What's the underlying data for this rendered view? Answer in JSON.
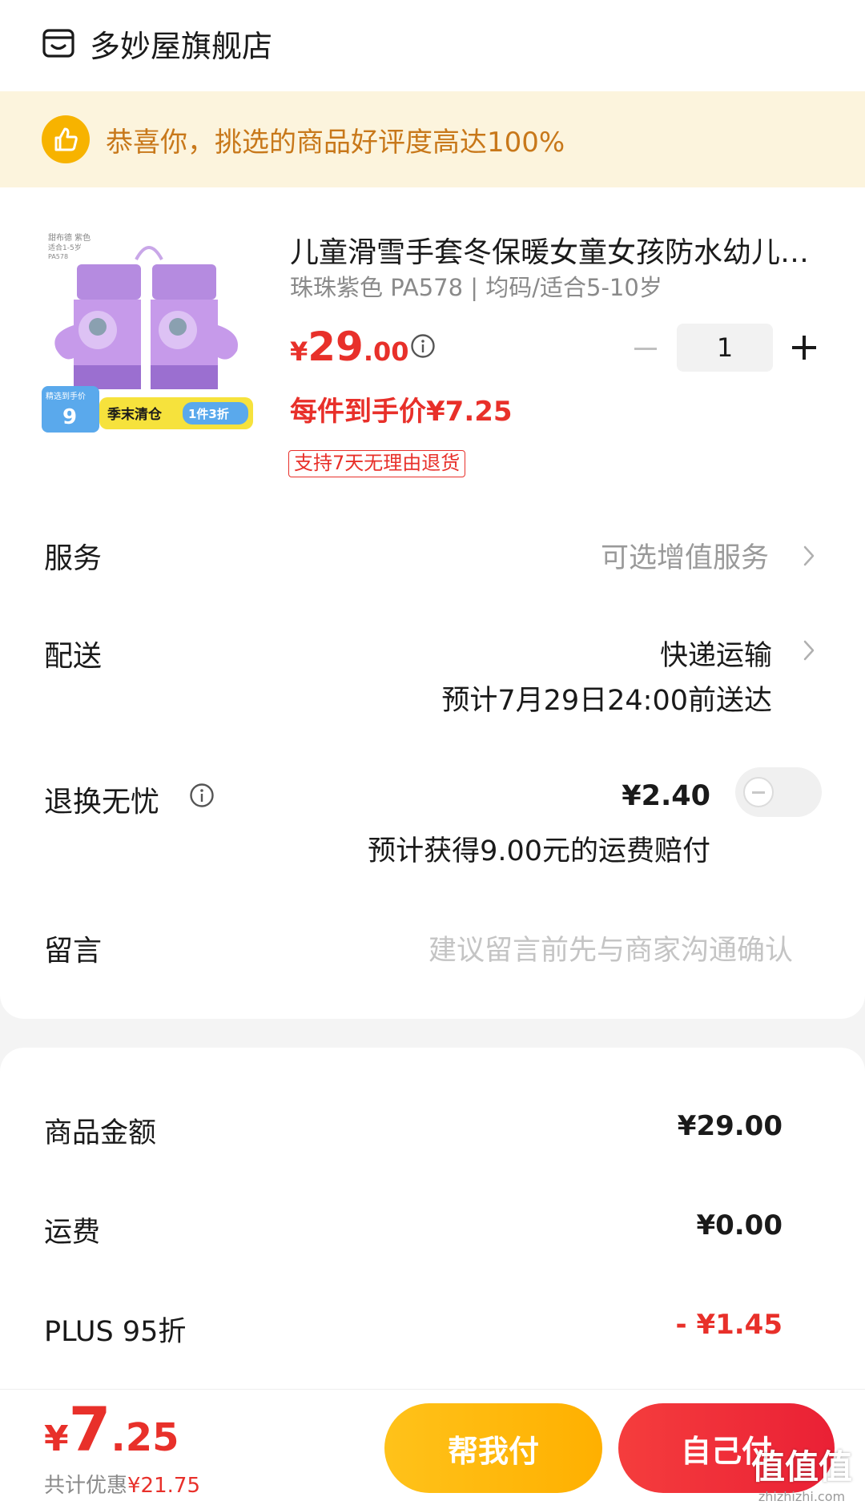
{
  "store": {
    "name": "多妙屋旗舰店",
    "icon": "store-icon"
  },
  "banner": {
    "text": "恭喜你，挑选的商品好评度高达100%",
    "icon": "thumbs-up-icon"
  },
  "product": {
    "title": "儿童滑雪手套冬保暖女童女孩防水幼儿园手套",
    "spec": "珠珠紫色 PA578 | 均码/适合5-10岁",
    "price_symbol": "¥",
    "price_int": "29",
    "price_dec": ".00",
    "unit_price": "每件到手价¥7.25",
    "return_tag": "支持7天无理由退货",
    "quantity": "1",
    "image_badge": {
      "tag_small": "精选到手价",
      "number": "9",
      "sale_text": "季末清仓",
      "discount_text": "1件3折",
      "small_print": [
        "甜布德 紫色",
        "适合1-5岁",
        "PA578"
      ]
    }
  },
  "rows": {
    "service": {
      "label": "服务",
      "value": "可选增值服务"
    },
    "delivery": {
      "label": "配送",
      "value": "快递运输",
      "eta": "预计7月29日24:00前送达"
    },
    "return_worry_free": {
      "label": "退换无忧",
      "price": "¥2.40",
      "desc": "预计获得9.00元的运费赔付",
      "enabled": false
    },
    "message": {
      "label": "留言",
      "placeholder": "建议留言前先与商家沟通确认"
    }
  },
  "summary": {
    "goods_label": "商品金额",
    "goods_value": "¥29.00",
    "shipping_label": "运费",
    "shipping_value": "¥0.00",
    "plus_label": "PLUS 95折",
    "plus_value": "- ¥1.45"
  },
  "footer": {
    "total_symbol": "¥",
    "total_int": "7",
    "total_dec": ".25",
    "saved_prefix": "共计优惠",
    "saved_value": "¥21.75",
    "btn_help": "帮我付",
    "btn_self": "自己付"
  },
  "watermark": {
    "logo": "值值值",
    "url": "zhizhizhi.com"
  },
  "colors": {
    "accent_red": "#e8302a",
    "banner_bg": "#fcf4dd",
    "banner_text": "#c8781a",
    "help_button": "#ffb000",
    "pay_button": "#ea2035"
  }
}
